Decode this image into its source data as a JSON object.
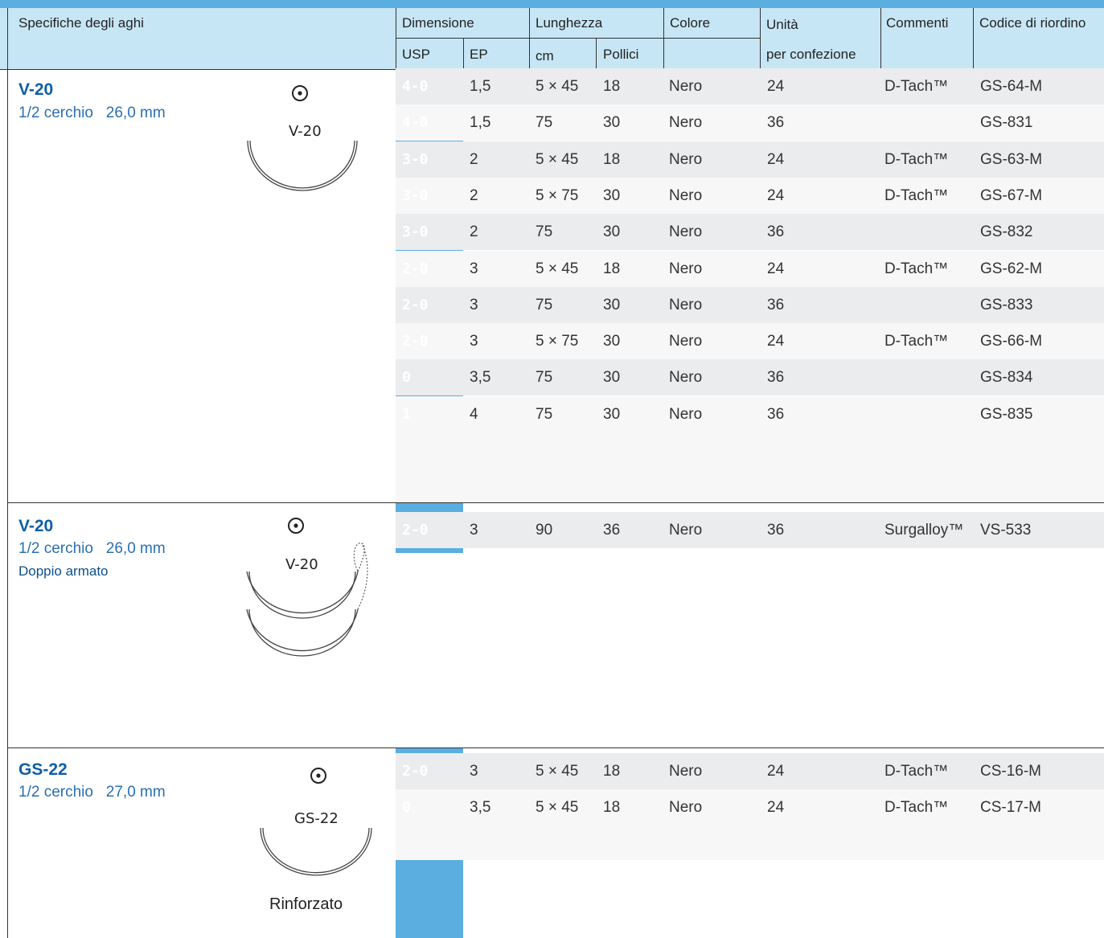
{
  "header": {
    "needle_specs": "Specifiche degli aghi",
    "dimension": "Dimensione",
    "usp": "USP",
    "ep": "EP",
    "length": "Lunghezza",
    "cm": "cm",
    "inches": "Pollici",
    "color": "Colore",
    "units_line1": "Unità",
    "units_line2": "per confezione",
    "comments": "Commenti",
    "reorder_code": "Codice di riordino"
  },
  "sections": [
    {
      "name": "V-20",
      "spec": "1/2 cerchio   26,0 mm",
      "extra": "",
      "drawing_label": "V-20",
      "drawing_note": "",
      "rows": [
        {
          "usp": "4-0",
          "ep": "1,5",
          "cm": "5 × 45",
          "inches": "18",
          "color": "Nero",
          "units": "24",
          "comment": "D-Tach™",
          "code": "GS-64-M"
        },
        {
          "usp": "4-0",
          "ep": "1,5",
          "cm": "75",
          "inches": "30",
          "color": "Nero",
          "units": "36",
          "comment": "",
          "code": "GS-831"
        },
        {
          "usp": "3-0",
          "ep": "2",
          "cm": "5 × 45",
          "inches": "18",
          "color": "Nero",
          "units": "24",
          "comment": "D-Tach™",
          "code": "GS-63-M"
        },
        {
          "usp": "3-0",
          "ep": "2",
          "cm": "5 × 75",
          "inches": "30",
          "color": "Nero",
          "units": "24",
          "comment": "D-Tach™",
          "code": "GS-67-M"
        },
        {
          "usp": "3-0",
          "ep": "2",
          "cm": "75",
          "inches": "30",
          "color": "Nero",
          "units": "36",
          "comment": "",
          "code": "GS-832"
        },
        {
          "usp": "2-0",
          "ep": "3",
          "cm": "5 × 45",
          "inches": "18",
          "color": "Nero",
          "units": "24",
          "comment": "D-Tach™",
          "code": "GS-62-M"
        },
        {
          "usp": "2-0",
          "ep": "3",
          "cm": "75",
          "inches": "30",
          "color": "Nero",
          "units": "36",
          "comment": "",
          "code": "GS-833"
        },
        {
          "usp": "2-0",
          "ep": "3",
          "cm": "5 × 75",
          "inches": "30",
          "color": "Nero",
          "units": "24",
          "comment": "D-Tach™",
          "code": "GS-66-M"
        },
        {
          "usp": "0",
          "ep": "3,5",
          "cm": "75",
          "inches": "30",
          "color": "Nero",
          "units": "36",
          "comment": "",
          "code": "GS-834"
        },
        {
          "usp": "1",
          "ep": "4",
          "cm": "75",
          "inches": "30",
          "color": "Nero",
          "units": "36",
          "comment": "",
          "code": "GS-835"
        }
      ]
    },
    {
      "name": "V-20",
      "spec": "1/2 cerchio   26,0 mm",
      "extra": "Doppio armato",
      "drawing_label": "V-20",
      "drawing_note": "",
      "rows": [
        {
          "usp": "2-0",
          "ep": "3",
          "cm": "90",
          "inches": "36",
          "color": "Nero",
          "units": "36",
          "comment": "Surgalloy™",
          "code": "VS-533"
        }
      ]
    },
    {
      "name": "GS-22",
      "spec": "1/2 cerchio   27,0 mm",
      "extra": "",
      "drawing_label": "GS-22",
      "drawing_note": "Rinforzato",
      "rows": [
        {
          "usp": "2-0",
          "ep": "3",
          "cm": "5 × 45",
          "inches": "18",
          "color": "Nero",
          "units": "24",
          "comment": "D-Tach™",
          "code": "CS-16-M"
        },
        {
          "usp": "0",
          "ep": "3,5",
          "cm": "5 × 45",
          "inches": "18",
          "color": "Nero",
          "units": "24",
          "comment": "D-Tach™",
          "code": "CS-17-M"
        }
      ]
    }
  ],
  "colors": {
    "header_bg": "#c7e6f5",
    "usp_band": "#5aaee0",
    "needle_name": "#0d5fa8",
    "row_shade": "#ebecee"
  }
}
